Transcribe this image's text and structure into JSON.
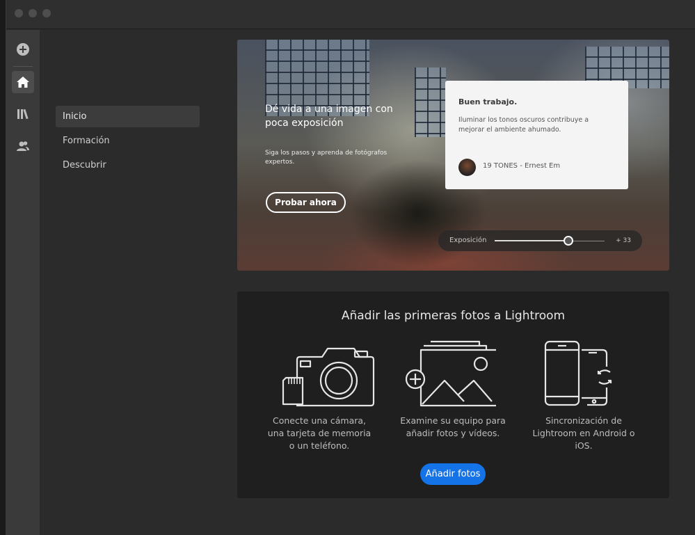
{
  "nav": {
    "items": [
      {
        "label": "Inicio",
        "active": true
      },
      {
        "label": "Formación",
        "active": false
      },
      {
        "label": "Descubrir",
        "active": false
      }
    ]
  },
  "rail": {
    "icons": [
      "add-icon",
      "home-icon",
      "library-icon",
      "people-icon"
    ]
  },
  "hero": {
    "title": "Dé vida a una imagen con poca exposición",
    "subtitle": "Siga los pasos y aprenda de fotógrafos expertos.",
    "button_label": "Probar ahora",
    "card": {
      "title": "Buen trabajo.",
      "text": "Iluminar los tonos oscuros contribuye a mejorar el ambiente ahumado.",
      "author": "19 TONES - Ernest Em"
    },
    "slider": {
      "label": "Exposición",
      "value_text": "+ 33",
      "position": 0.67
    }
  },
  "panel": {
    "title": "Añadir las primeras fotos a Lightroom",
    "options": [
      {
        "icon": "camera-card-icon",
        "text": "Conecte una cámara, una tarjeta de memoria o un teléfono."
      },
      {
        "icon": "add-photo-icon",
        "text": "Examine su equipo para añadir fotos y vídeos."
      },
      {
        "icon": "phone-sync-icon",
        "text": "Sincronización de Lightroom en Android o iOS."
      }
    ],
    "button_label": "Añadir fotos"
  },
  "colors": {
    "accent": "#1473e6"
  }
}
